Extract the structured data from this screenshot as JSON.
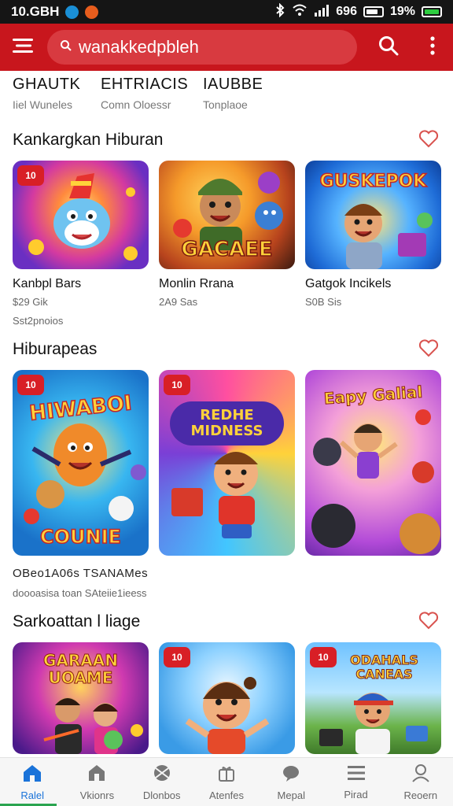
{
  "status": {
    "time": "10.GBH",
    "network": "696",
    "battery": "19%",
    "dot_colors": [
      "#1a8fd6",
      "#e85d1d"
    ]
  },
  "appbar": {
    "search_value": "wanakkedpbleh",
    "icons": [
      "menu-icon",
      "search-icon",
      "more-vert-icon"
    ]
  },
  "tabs": [
    {
      "title": "GHAUTK",
      "sub": "Iiel Wuneles"
    },
    {
      "title": "EHTRIACIS",
      "sub": "Comn Oloessr"
    },
    {
      "title": "IAUBBE",
      "sub": "Tonplaoe"
    }
  ],
  "sections": [
    {
      "title": "Kankargkan Hiburan",
      "cards": [
        {
          "badge": "10",
          "name": "Kanbpl Bars",
          "meta": "$29 Gik",
          "art_text": ""
        },
        {
          "badge": "",
          "name": "Monlin Rrana",
          "meta": "2A9 Sas",
          "art_text": "GACAEE"
        },
        {
          "badge": "",
          "name": "Gatgok Incikels",
          "meta": "S0B Sis",
          "art_text": "GUSKEPOK"
        }
      ],
      "caption": "Sst2pnoios"
    },
    {
      "title": "Hiburapeas",
      "cards": [
        {
          "badge": "10",
          "name": "",
          "meta": "",
          "art_text": "HIWABOI",
          "art_text2": "COUNIE"
        },
        {
          "badge": "10",
          "name": "",
          "meta": "",
          "art_text": "REDHE MIDNESS"
        },
        {
          "badge": "",
          "name": "",
          "meta": "",
          "art_text": "Eapy Galial"
        }
      ],
      "caption": "OBeo1A06s TSANAMes",
      "caption2": "doooasisa toan SAteiie1ieess"
    },
    {
      "title": "Sarkoattan l liage",
      "cards": [
        {
          "badge": "",
          "name": "",
          "meta": "",
          "art_text": "GARAAN UOAME"
        },
        {
          "badge": "10",
          "name": "",
          "meta": "",
          "art_text": ""
        },
        {
          "badge": "10",
          "name": "",
          "meta": "",
          "art_text": "ODAHALS CANEAS"
        }
      ]
    }
  ],
  "bottom_nav": [
    {
      "label": "Ralel",
      "icon": "home-icon",
      "active": true
    },
    {
      "label": "Vkionrs",
      "icon": "house-icon",
      "active": false
    },
    {
      "label": "Dlonbos",
      "icon": "ball-icon",
      "active": false
    },
    {
      "label": "Atenfes",
      "icon": "gift-icon",
      "active": false
    },
    {
      "label": "Mepal",
      "icon": "chat-icon",
      "active": false
    },
    {
      "label": "Pirad",
      "icon": "list-icon",
      "active": false
    },
    {
      "label": "Reoern",
      "icon": "person-icon",
      "active": false
    }
  ],
  "colors": {
    "brand_red": "#c8161d",
    "badge_red": "#d81f26",
    "active_blue": "#1a73d9",
    "active_green": "#2aa44f"
  }
}
